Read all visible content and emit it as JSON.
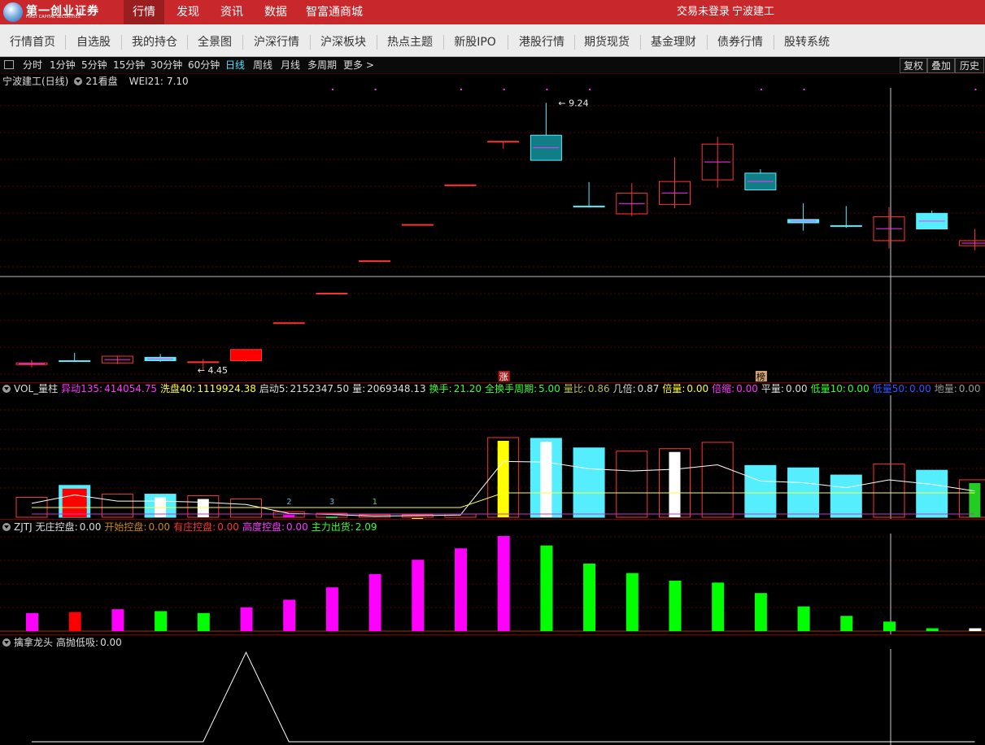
{
  "logo": {
    "cn": "第一创业证券",
    "en": "FIRST CAPITAL SECURITIES"
  },
  "top_nav": [
    "行情",
    "发现",
    "资讯",
    "数据",
    "智富通商城"
  ],
  "top_right": {
    "login_status": "交易未登录",
    "stock": "宁波建工"
  },
  "menu": [
    "行情首页",
    "自选股",
    "我的持仓",
    "全景图",
    "沪深行情",
    "沪深板块",
    "热点主题",
    "新股IPO",
    "港股行情",
    "期货现货",
    "基金理财",
    "债券行情",
    "股转系统"
  ],
  "periods": [
    "分时",
    "1分钟",
    "5分钟",
    "15分钟",
    "30分钟",
    "60分钟",
    "日线",
    "周线",
    "月线",
    "多周期",
    "更多 >"
  ],
  "active_period": "日线",
  "right_buttons": [
    "复权",
    "叠加",
    "历史"
  ],
  "kline": {
    "title": "宁波建工(日线)",
    "indicator": "21看盘",
    "wei_label": "WEI21:",
    "wei_value": "7.10",
    "high_label": "9.24",
    "low_label": "4.45",
    "badges": [
      "涨",
      "榜"
    ],
    "candles": [
      {
        "o": 4.55,
        "c": 4.58,
        "h": 4.63,
        "l": 4.5,
        "col": "hollow_red"
      },
      {
        "o": 4.62,
        "c": 4.62,
        "h": 4.76,
        "l": 4.6,
        "col": "cyan_line"
      },
      {
        "o": 4.58,
        "c": 4.7,
        "h": 4.7,
        "l": 4.56,
        "col": "hollow_red"
      },
      {
        "o": 4.62,
        "c": 4.68,
        "h": 4.74,
        "l": 4.6,
        "col": "cyan"
      },
      {
        "o": 4.6,
        "c": 4.59,
        "h": 4.65,
        "l": 4.45,
        "col": "red_line"
      },
      {
        "o": 4.62,
        "c": 4.82,
        "h": 4.82,
        "l": 4.6,
        "col": "red"
      },
      {
        "o": 5.3,
        "c": 5.3,
        "h": 5.3,
        "l": 5.3,
        "col": "red_line"
      },
      {
        "o": 5.83,
        "c": 5.83,
        "h": 5.83,
        "l": 5.83,
        "col": "red_line"
      },
      {
        "o": 6.41,
        "c": 6.41,
        "h": 6.41,
        "l": 6.41,
        "col": "red_line"
      },
      {
        "o": 7.06,
        "c": 7.06,
        "h": 7.06,
        "l": 7.06,
        "col": "red_line"
      },
      {
        "o": 7.77,
        "c": 7.77,
        "h": 7.77,
        "l": 7.77,
        "col": "red_line"
      },
      {
        "o": 8.55,
        "c": 8.55,
        "h": 8.55,
        "l": 8.42,
        "col": "red_line"
      },
      {
        "o": 8.66,
        "c": 8.21,
        "h": 9.24,
        "l": 8.21,
        "col": "teal"
      },
      {
        "o": 7.39,
        "c": 7.38,
        "h": 7.82,
        "l": 7.38,
        "col": "cyan_line"
      },
      {
        "o": 7.25,
        "c": 7.62,
        "h": 7.8,
        "l": 7.21,
        "col": "hollow_red"
      },
      {
        "o": 7.42,
        "c": 7.83,
        "h": 8.26,
        "l": 7.35,
        "col": "hollow_red"
      },
      {
        "o": 7.86,
        "c": 8.5,
        "h": 8.63,
        "l": 7.72,
        "col": "hollow_red"
      },
      {
        "o": 7.98,
        "c": 7.68,
        "h": 8.05,
        "l": 7.68,
        "col": "teal"
      },
      {
        "o": 7.15,
        "c": 7.09,
        "h": 7.44,
        "l": 6.95,
        "col": "cyan"
      },
      {
        "o": 7.04,
        "c": 7.04,
        "h": 7.39,
        "l": 7.0,
        "col": "cyan_line"
      },
      {
        "o": 6.77,
        "c": 7.2,
        "h": 7.37,
        "l": 6.63,
        "col": "hollow_red"
      },
      {
        "o": 6.98,
        "c": 7.26,
        "h": 7.31,
        "l": 6.98,
        "col": "cyan"
      },
      {
        "o": 6.68,
        "c": 6.77,
        "h": 6.98,
        "l": 6.6,
        "col": "hollow_red"
      }
    ]
  },
  "vol": {
    "name": "VOL_量柱",
    "legend": [
      {
        "k": "异动135:",
        "v": "414054.75",
        "c": "m"
      },
      {
        "k": "洗盘40:",
        "v": "1119924.38",
        "c": "y"
      },
      {
        "k": "启动5:",
        "v": "2152347.50",
        "c": "w"
      },
      {
        "k": "量:",
        "v": "2069348.13",
        "c": "w"
      },
      {
        "k": "换手:",
        "v": "21.20",
        "c": "g"
      },
      {
        "k": "全换手周期:",
        "v": "5.00",
        "c": "g"
      },
      {
        "k": "量比:",
        "v": "0.86",
        "c": "gr"
      },
      {
        "k": "几倍:",
        "v": "0.87",
        "c": "w"
      },
      {
        "k": "倍量:",
        "v": "0.00",
        "c": "y"
      },
      {
        "k": "倍缩:",
        "v": "0.00",
        "c": "m"
      },
      {
        "k": "平量:",
        "v": "0.00",
        "c": "w"
      },
      {
        "k": "低量10:",
        "v": "0.00",
        "c": "g"
      },
      {
        "k": "低量50:",
        "v": "0.00",
        "c": "b"
      },
      {
        "k": "地量:",
        "v": "0.00",
        "c": "gy"
      }
    ],
    "marks": [
      "2",
      "3",
      "1"
    ],
    "bars": [
      {
        "v": 0.25,
        "col": "hollow_red"
      },
      {
        "v": 0.4,
        "col": "red_cyan"
      },
      {
        "v": 0.29,
        "col": "hollow_red"
      },
      {
        "v": 0.29,
        "col": "cyan_white"
      },
      {
        "v": 0.27,
        "col": "white_hollow"
      },
      {
        "v": 0.23,
        "col": "hollow_red"
      },
      {
        "v": 0.07,
        "col": "hollow_magenta"
      },
      {
        "v": 0.05,
        "col": "hollow_green"
      },
      {
        "v": 0.02,
        "col": "hollow_red"
      },
      {
        "v": 0.03,
        "col": "hollow_yellow"
      },
      {
        "v": 0.04,
        "col": "hollow_red"
      },
      {
        "v": 1.0,
        "col": "yellow_hollow"
      },
      {
        "v": 0.99,
        "col": "cyan_white"
      },
      {
        "v": 0.87,
        "col": "cyan"
      },
      {
        "v": 0.83,
        "col": "hollow_red"
      },
      {
        "v": 0.86,
        "col": "white_hollow"
      },
      {
        "v": 0.94,
        "col": "hollow_red"
      },
      {
        "v": 0.65,
        "col": "cyan"
      },
      {
        "v": 0.62,
        "col": "cyan"
      },
      {
        "v": 0.53,
        "col": "cyan"
      },
      {
        "v": 0.67,
        "col": "hollow_red"
      },
      {
        "v": 0.59,
        "col": "cyan"
      },
      {
        "v": 0.47,
        "col": "green_hollow"
      }
    ]
  },
  "zjtj": {
    "name": "ZJTJ",
    "legend": [
      {
        "k": "无庄控盘:",
        "v": "0.00",
        "c": "w"
      },
      {
        "k": "开始控盘:",
        "v": "0.00",
        "c": "o"
      },
      {
        "k": "有庄控盘:",
        "v": "0.00",
        "c": "r"
      },
      {
        "k": "高度控盘:",
        "v": "0.00",
        "c": "m"
      },
      {
        "k": "主力出货:",
        "v": "2.09",
        "c": "g"
      }
    ],
    "bars": [
      {
        "v": 0.19,
        "col": "m"
      },
      {
        "v": 0.2,
        "col": "r"
      },
      {
        "v": 0.23,
        "col": "m"
      },
      {
        "v": 0.21,
        "col": "g"
      },
      {
        "v": 0.19,
        "col": "g"
      },
      {
        "v": 0.25,
        "col": "m"
      },
      {
        "v": 0.33,
        "col": "m"
      },
      {
        "v": 0.46,
        "col": "m"
      },
      {
        "v": 0.6,
        "col": "m"
      },
      {
        "v": 0.75,
        "col": "m"
      },
      {
        "v": 0.87,
        "col": "m"
      },
      {
        "v": 1.0,
        "col": "m"
      },
      {
        "v": 0.9,
        "col": "g"
      },
      {
        "v": 0.71,
        "col": "g"
      },
      {
        "v": 0.61,
        "col": "g"
      },
      {
        "v": 0.53,
        "col": "g"
      },
      {
        "v": 0.51,
        "col": "g"
      },
      {
        "v": 0.4,
        "col": "g"
      },
      {
        "v": 0.26,
        "col": "g"
      },
      {
        "v": 0.16,
        "col": "g"
      },
      {
        "v": 0.1,
        "col": "g"
      },
      {
        "v": 0.03,
        "col": "g"
      },
      {
        "v": 0.03,
        "col": "w"
      }
    ]
  },
  "bottom": {
    "name": "擒拿龙头",
    "legend_k": "高抛低吸:",
    "legend_v": "0.00",
    "series": [
      0,
      0,
      0,
      0,
      0,
      1,
      0,
      0,
      0,
      0,
      0,
      0,
      0,
      0,
      0,
      0,
      0,
      0,
      0,
      0,
      0,
      0,
      0
    ]
  },
  "colors": {
    "accent_red": "#c8282b",
    "cyan": "#55eeff",
    "teal": "#107d87",
    "magenta": "#ff00ff",
    "green": "#00ff00",
    "grid": "#6b0000"
  }
}
